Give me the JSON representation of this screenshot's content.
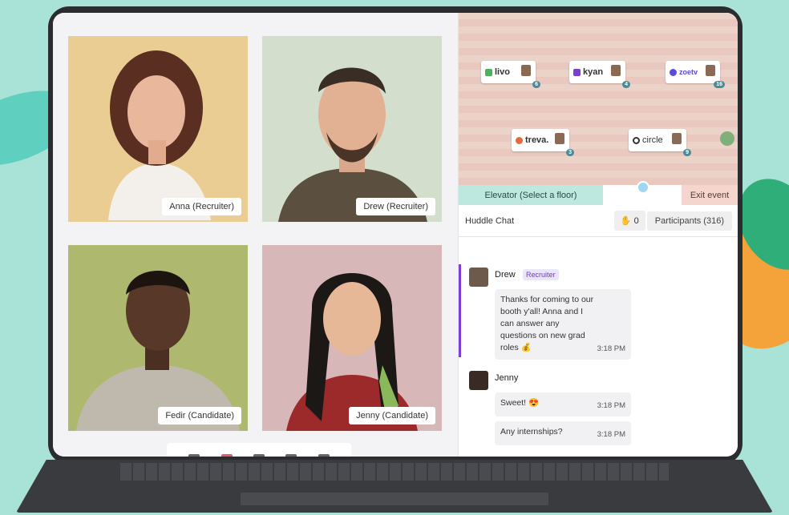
{
  "video_grid": {
    "tiles": [
      {
        "name": "Anna (Recruiter)"
      },
      {
        "name": "Drew (Recruiter)"
      },
      {
        "name": "Fedir (Candidate)"
      },
      {
        "name": "Jenny (Candidate)"
      }
    ]
  },
  "floor": {
    "booths": [
      {
        "label": "livo",
        "count": "6"
      },
      {
        "label": "kyan",
        "count": "4"
      },
      {
        "label": "zoetv",
        "count": "16"
      },
      {
        "label": "treva.",
        "count": "3"
      },
      {
        "label": "circle",
        "count": "9"
      }
    ],
    "elevator_label": "Elevator (Select a floor)",
    "exit_label": "Exit event"
  },
  "huddle": {
    "title": "Huddle Chat",
    "hands_count": "0",
    "participants_label": "Participants (316)"
  },
  "chat": {
    "messages": [
      {
        "author": "Drew",
        "role": "Recruiter",
        "text": "Thanks for coming to our booth y'all! Anna and I can answer any questions on new grad roles 💰",
        "time": "3:18 PM"
      },
      {
        "author": "Jenny",
        "text": "Sweet! 😍",
        "time": "3:18 PM"
      },
      {
        "text": "Any internships?",
        "time": "3:18 PM"
      }
    ]
  },
  "colors": {
    "background": "#a9e2d7",
    "accent_purple": "#7b3fd1",
    "elevator": "#bde8e0",
    "exit": "#f4d6cf"
  }
}
